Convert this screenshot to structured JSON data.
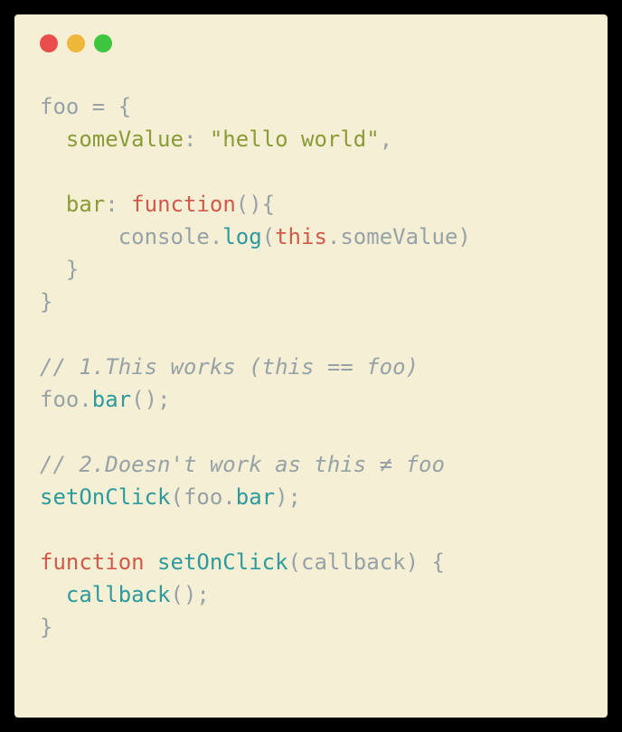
{
  "window": {
    "traffic_lights": {
      "close": "close",
      "minimize": "minimize",
      "maximize": "maximize"
    }
  },
  "colors": {
    "background": "#f5efd5",
    "default": "#97a2a7",
    "property": "#8a9b38",
    "string": "#8a9b38",
    "keyword": "#d15a4a",
    "identifier": "#2e9a9c",
    "comment": "#97a2a7"
  },
  "code": {
    "l1": {
      "t1": "foo = {"
    },
    "l2": {
      "t1": "  ",
      "t2": "someValue",
      "t3": ": ",
      "t4": "\"hello world\"",
      "t5": ","
    },
    "l3": {
      "t1": ""
    },
    "l4": {
      "t1": "  ",
      "t2": "bar",
      "t3": ": ",
      "t4": "function",
      "t5": "(){"
    },
    "l5": {
      "t1": "      console.",
      "t2": "log",
      "t3": "(",
      "t4": "this",
      "t5": ".someValue)"
    },
    "l6": {
      "t1": "  }"
    },
    "l7": {
      "t1": "}"
    },
    "l8": {
      "t1": ""
    },
    "l9": {
      "t1": "// 1.This works (this == foo)"
    },
    "l10": {
      "t1": "foo.",
      "t2": "bar",
      "t3": "();"
    },
    "l11": {
      "t1": ""
    },
    "l12": {
      "t1": "// 2.Doesn't work as this ≠ foo"
    },
    "l13": {
      "t1": "setOnClick",
      "t2": "(foo.",
      "t3": "bar",
      "t4": ");"
    },
    "l14": {
      "t1": ""
    },
    "l15": {
      "t1": "function",
      "t2": " ",
      "t3": "setOnClick",
      "t4": "(callback) {"
    },
    "l16": {
      "t1": "  ",
      "t2": "callback",
      "t3": "();"
    },
    "l17": {
      "t1": "}"
    }
  }
}
